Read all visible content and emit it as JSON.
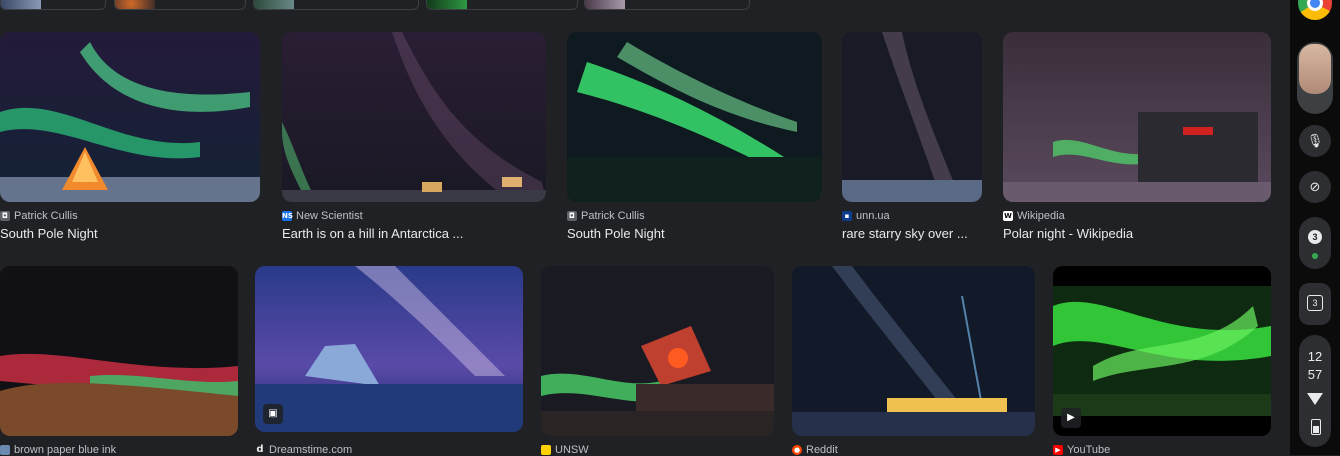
{
  "row1": [
    {
      "source": "Patrick Cullis",
      "title": "South Pole Night",
      "favicon": "camera-favicon"
    },
    {
      "source": "New Scientist",
      "title": "Earth is on a hill in Antarctica ...",
      "favicon": "NS"
    },
    {
      "source": "Patrick Cullis",
      "title": "South Pole Night",
      "favicon": "camera-favicon"
    },
    {
      "source": "unn.ua",
      "title": "rare starry sky over ...",
      "favicon": "unn"
    },
    {
      "source": "Wikipedia",
      "title": "Polar night - Wikipedia",
      "favicon": "W"
    }
  ],
  "row2": [
    {
      "source": "brown paper blue ink",
      "favicon": "bp"
    },
    {
      "source": "Dreamstime.com",
      "favicon": "d",
      "badge_icon": "image-icon"
    },
    {
      "source": "UNSW",
      "favicon": "unsw"
    },
    {
      "source": "Reddit",
      "favicon": "reddit"
    },
    {
      "source": "YouTube",
      "favicon": "youtube",
      "badge_icon": "play-icon"
    }
  ],
  "shelf": {
    "notification_count": "3",
    "desk_number": "3",
    "clock_hour": "12",
    "clock_minute": "57"
  },
  "colors": {
    "background": "#202124",
    "shelf": "#0b0b0c",
    "aurora": "#2ee66b"
  }
}
